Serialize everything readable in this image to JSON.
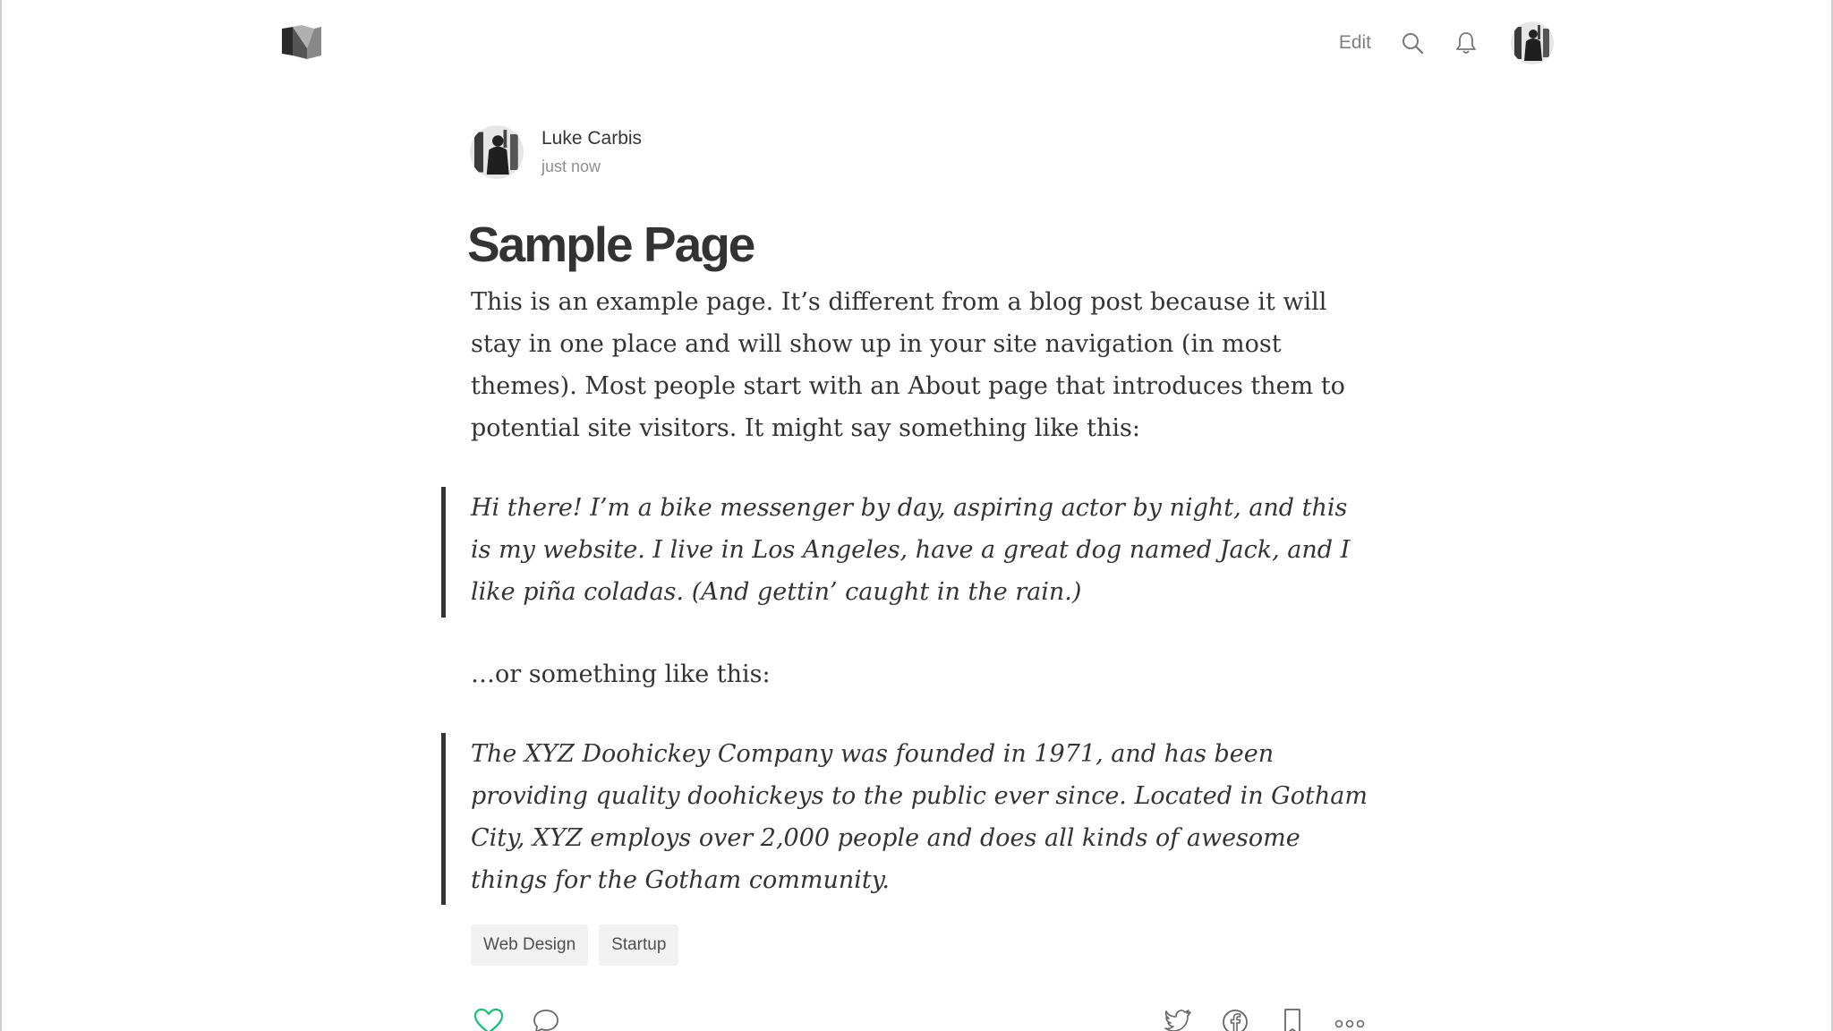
{
  "header": {
    "logo_icon": "medium-logo-icon",
    "edit_label": "Edit",
    "icons": [
      "search-icon",
      "bell-icon",
      "avatar"
    ]
  },
  "author": {
    "name": "Luke Carbis",
    "time": "just now"
  },
  "article": {
    "title": "Sample Page",
    "paragraph1": "This is an example page. It’s different from a blog post because it will stay in one place and will show up in your site navigation (in most themes). Most people start with an About page that introduces them to potential site visitors. It might say something like this:",
    "quote1": "Hi there! I’m a bike messenger by day, aspiring actor by night, and this is my website. I live in Los Angeles, have a great dog named Jack, and I like piña coladas. (And gettin’ caught in the rain.)",
    "paragraph2": "…or something like this:",
    "quote2": "The XYZ Doohickey Company was founded in 1971, and has been providing quality doohickeys to the public ever since. Located in Gotham City, XYZ employs over 2,000 people and does all kinds of awesome things for the Gotham community."
  },
  "tags": [
    "Web Design",
    "Startup"
  ],
  "footer_actions": {
    "left": [
      "heart-icon",
      "comment-icon"
    ],
    "right": [
      "twitter-icon",
      "facebook-icon",
      "bookmark-icon",
      "more-icon"
    ]
  },
  "colors": {
    "accent_green": "#1abc78",
    "text": "#333333",
    "muted": "#8c8c8c"
  }
}
